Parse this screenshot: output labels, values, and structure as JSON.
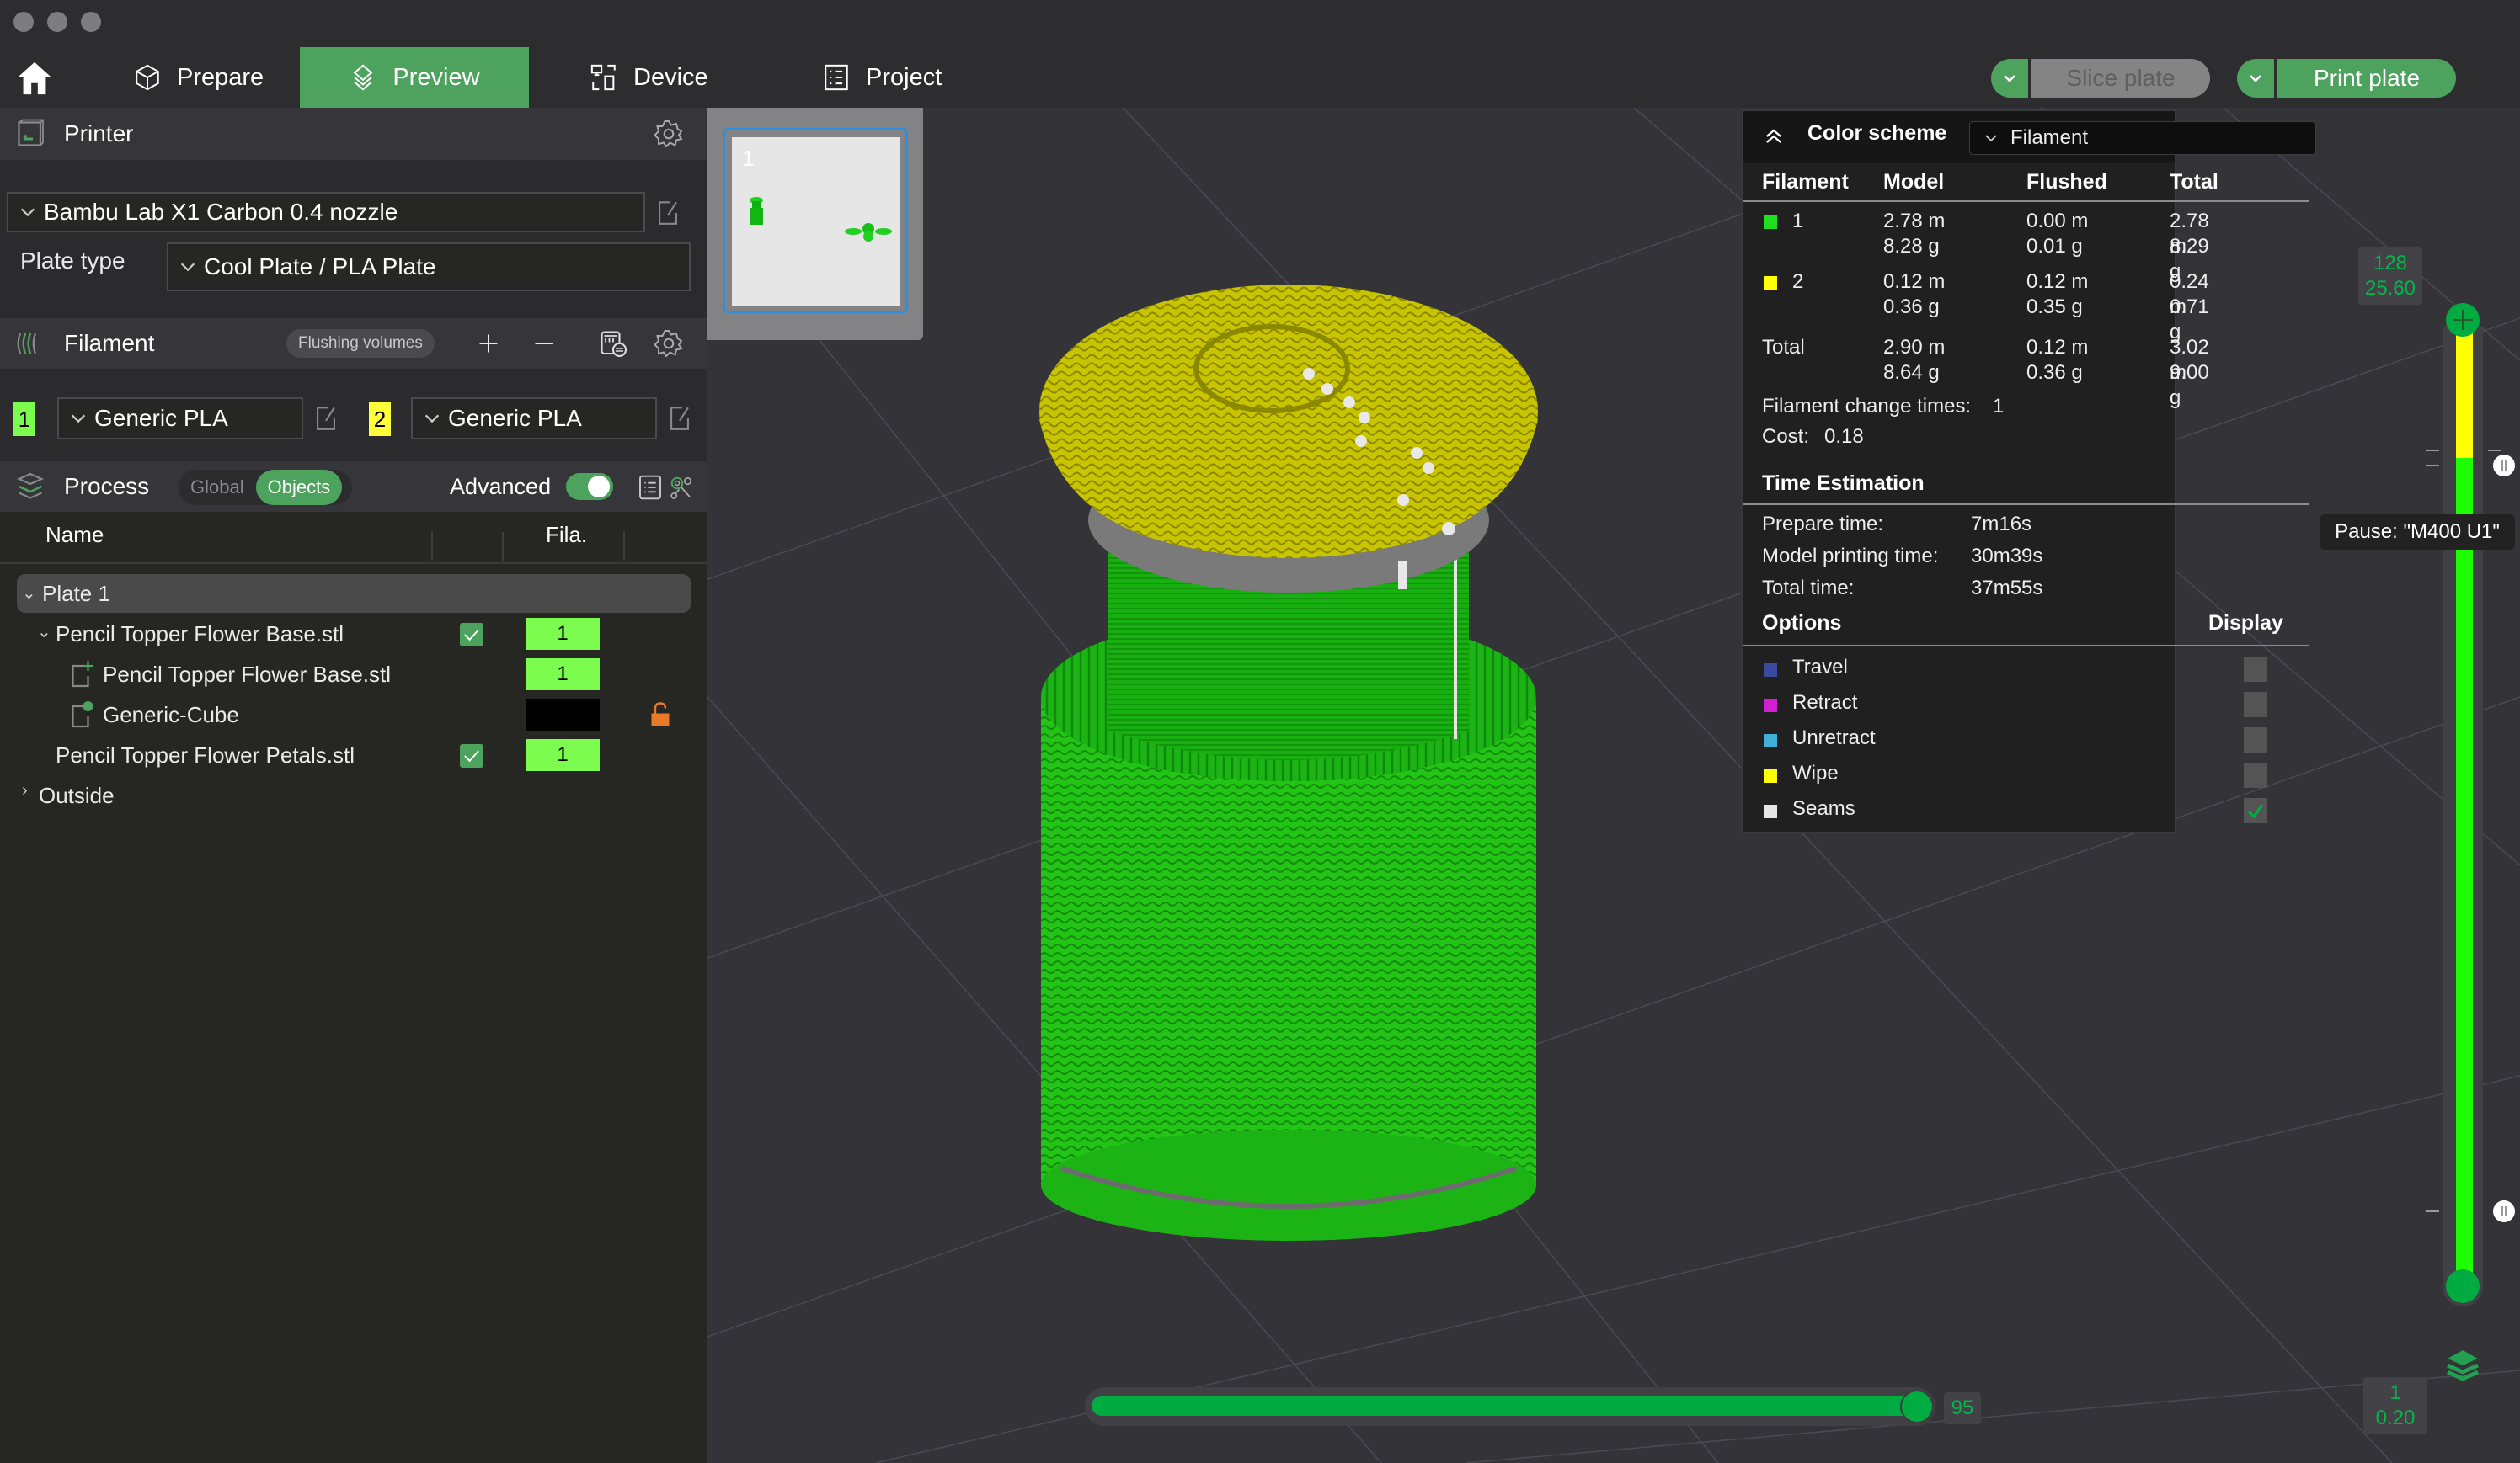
{
  "window": {
    "tabs": [
      {
        "label": "Prepare",
        "icon": "cube-icon",
        "active": false
      },
      {
        "label": "Preview",
        "icon": "layers-icon",
        "active": true
      },
      {
        "label": "Device",
        "icon": "device-icon",
        "active": false
      },
      {
        "label": "Project",
        "icon": "list-icon",
        "active": false
      }
    ],
    "slice_label": "Slice plate",
    "print_label": "Print plate"
  },
  "sidebar": {
    "printer": {
      "title": "Printer",
      "selected": "Bambu Lab X1 Carbon 0.4 nozzle",
      "plate_type_label": "Plate type",
      "plate_type": "Cool Plate / PLA Plate"
    },
    "filament": {
      "title": "Filament",
      "flushing_label": "Flushing volumes",
      "slots": [
        {
          "index": "1",
          "name": "Generic PLA",
          "color": "#7cfc4e"
        },
        {
          "index": "2",
          "name": "Generic PLA",
          "color": "#ffff00"
        }
      ]
    },
    "process": {
      "title": "Process",
      "seg_global": "Global",
      "seg_objects": "Objects",
      "advanced_label": "Advanced",
      "advanced_on": true
    },
    "objects": {
      "col_name": "Name",
      "col_fila": "Fila.",
      "plate": "Plate 1",
      "items": [
        {
          "name": "Pencil Topper Flower Base.stl",
          "checked": true,
          "fila": "1"
        },
        {
          "name": "Pencil Topper Flower Base.stl",
          "fila": "1"
        },
        {
          "name": "Generic-Cube",
          "fila": ""
        },
        {
          "name": "Pencil Topper Flower Petals.stl",
          "checked": true,
          "fila": "1"
        }
      ],
      "outside": "Outside"
    }
  },
  "viewport": {
    "thumbnail_plate": "1",
    "legend": {
      "title": "Color scheme",
      "scheme": "Filament",
      "headers": [
        "Filament",
        "Model",
        "Flushed",
        "Total"
      ],
      "rows": [
        {
          "id": "1",
          "color": "#1ee01e",
          "model_m": "2.78 m",
          "model_g": "8.28 g",
          "flushed_m": "0.00 m",
          "flushed_g": "0.01 g",
          "total_m": "2.78 m",
          "total_g": "8.29 g"
        },
        {
          "id": "2",
          "color": "#ffff00",
          "model_m": "0.12 m",
          "model_g": "0.36 g",
          "flushed_m": "0.12 m",
          "flushed_g": "0.35 g",
          "total_m": "0.24 m",
          "total_g": "0.71 g"
        }
      ],
      "total": {
        "label": "Total",
        "model_m": "2.90 m",
        "model_g": "8.64 g",
        "flushed_m": "0.12 m",
        "flushed_g": "0.36 g",
        "total_m": "3.02 m",
        "total_g": "9.00 g"
      },
      "change_times_label": "Filament change times:",
      "change_times": "1",
      "cost_label": "Cost:",
      "cost": "0.18",
      "time_title": "Time Estimation",
      "prepare_label": "Prepare time:",
      "prepare": "7m16s",
      "model_time_label": "Model printing time:",
      "model_time": "30m39s",
      "total_time_label": "Total time:",
      "total_time": "37m55s",
      "options_title": "Options",
      "display_title": "Display",
      "options": [
        {
          "label": "Travel",
          "color": "#3a4aa0",
          "checked": false
        },
        {
          "label": "Retract",
          "color": "#d21fd2",
          "checked": false
        },
        {
          "label": "Unretract",
          "color": "#3fb0d8",
          "checked": false
        },
        {
          "label": "Wipe",
          "color": "#ffff00",
          "checked": false
        },
        {
          "label": "Seams",
          "color": "#e6e6e6",
          "checked": true
        }
      ]
    },
    "layer_slider": {
      "top_layer": "128",
      "top_height": "25.60",
      "bottom_layer": "1",
      "bottom_height": "0.20",
      "pause_tooltip": "Pause: \"M400 U1\""
    },
    "move_slider": {
      "value": "95",
      "fraction": 1.0
    }
  }
}
